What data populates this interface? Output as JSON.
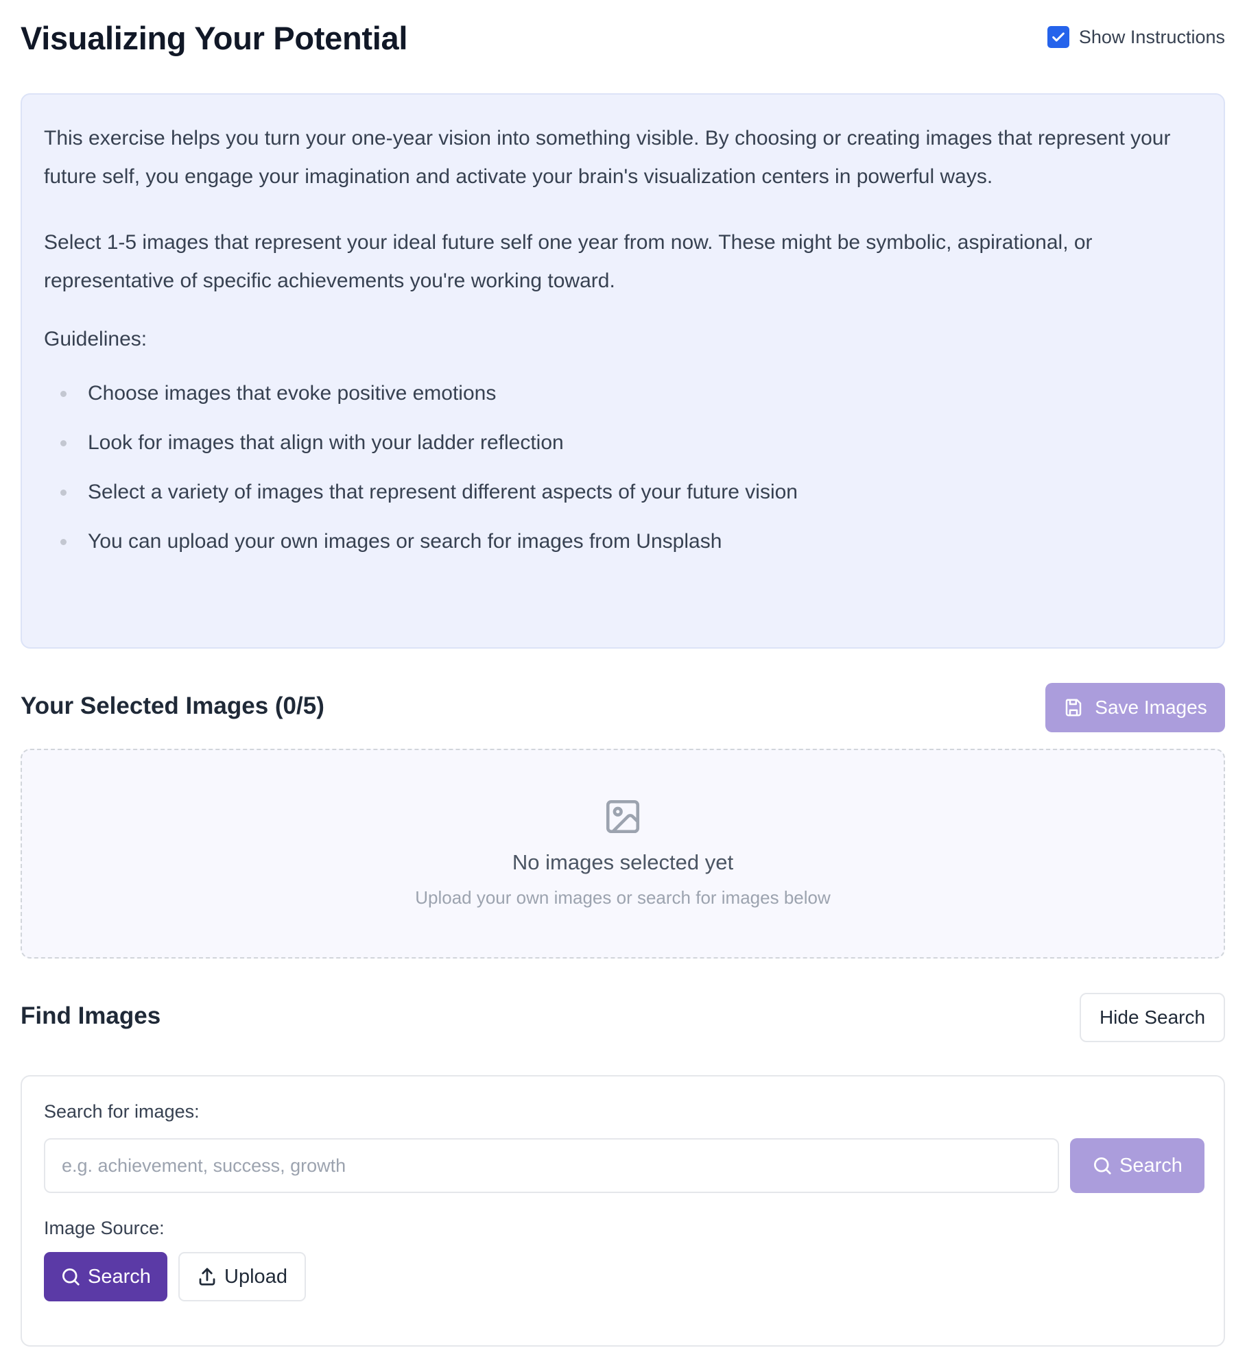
{
  "header": {
    "title": "Visualizing Your Potential",
    "show_instructions_label": "Show Instructions",
    "show_instructions_checked": true
  },
  "instructions": {
    "paragraph_1": "This exercise helps you turn your one-year vision into something visible. By choosing or creating images that represent your future self, you engage your imagination and activate your brain's visualization centers in powerful ways.",
    "paragraph_2": "Select 1-5 images that represent your ideal future self one year from now. These might be symbolic, aspirational, or representative of specific achievements you're working toward.",
    "guidelines_title": "Guidelines:",
    "guidelines": [
      "Choose images that evoke positive emotions",
      "Look for images that align with your ladder reflection",
      "Select a variety of images that represent different aspects of your future vision",
      "You can upload your own images or search for images from Unsplash"
    ]
  },
  "selected": {
    "heading": "Your Selected Images (0/5)",
    "save_label": "Save Images",
    "empty_title": "No images selected yet",
    "empty_subtitle": "Upload your own images or search for images below"
  },
  "find": {
    "heading": "Find Images",
    "hide_label": "Hide Search",
    "search_label": "Search for images:",
    "search_placeholder": "e.g. achievement, success, growth",
    "search_value": "",
    "search_button_label": "Search",
    "source_label": "Image Source:",
    "source_options": [
      "Search",
      "Upload"
    ],
    "source_selected": "Search"
  },
  "icons": {
    "checkbox": "check-icon",
    "save": "save-icon",
    "empty": "image-icon",
    "search": "search-icon",
    "upload": "upload-icon"
  },
  "colors": {
    "accent": "#5b3aa6",
    "accent_disabled": "#ab9ddc",
    "checkbox": "#2563eb",
    "instructions_bg": "#eef1fd"
  }
}
